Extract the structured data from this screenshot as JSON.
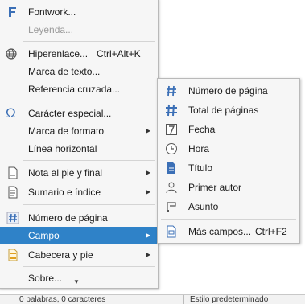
{
  "main_menu": {
    "items": [
      {
        "label": "Fontwork...",
        "icon": "fontwork-icon"
      },
      {
        "label": "Leyenda...",
        "disabled": true
      },
      {
        "label": "Hiperenlace...",
        "shortcut": "Ctrl+Alt+K",
        "icon": "hyperlink-globe-icon"
      },
      {
        "label": "Marca de texto..."
      },
      {
        "label": "Referencia cruzada..."
      },
      {
        "label": "Carácter especial...",
        "icon": "omega-icon"
      },
      {
        "label": "Marca de formato",
        "submenu": true
      },
      {
        "label": "Línea horizontal"
      },
      {
        "label": "Nota al pie y final",
        "submenu": true,
        "icon": "footnote-icon"
      },
      {
        "label": "Sumario e índice",
        "submenu": true,
        "icon": "index-icon"
      },
      {
        "label": "Número de página",
        "icon": "page-number-icon"
      },
      {
        "label": "Campo",
        "submenu": true,
        "selected": true
      },
      {
        "label": "Cabecera y pie",
        "submenu": true,
        "icon": "header-footer-icon"
      },
      {
        "label": "Sobre...",
        "icon": "more-arrow-icon"
      }
    ]
  },
  "submenu": {
    "items": [
      {
        "label": "Número de página",
        "icon": "page-number-doc-icon"
      },
      {
        "label": "Total de páginas",
        "icon": "page-count-icon"
      },
      {
        "label": "Fecha",
        "icon": "date-icon"
      },
      {
        "label": "Hora",
        "icon": "clock-icon"
      },
      {
        "label": "Título",
        "icon": "title-doc-icon"
      },
      {
        "label": "Primer autor",
        "icon": "author-icon"
      },
      {
        "label": "Asunto",
        "icon": "subject-icon"
      },
      {
        "label": "Más campos...",
        "shortcut": "Ctrl+F2",
        "icon": "more-fields-icon"
      }
    ]
  },
  "statusbar": {
    "words": "0 palabras, 0 caracteres",
    "style": "Estilo predeterminado"
  },
  "colors": {
    "accent": "#2f82c8",
    "menu_bg": "#f6f6f6",
    "icon_blue": "#3b6fb6"
  }
}
